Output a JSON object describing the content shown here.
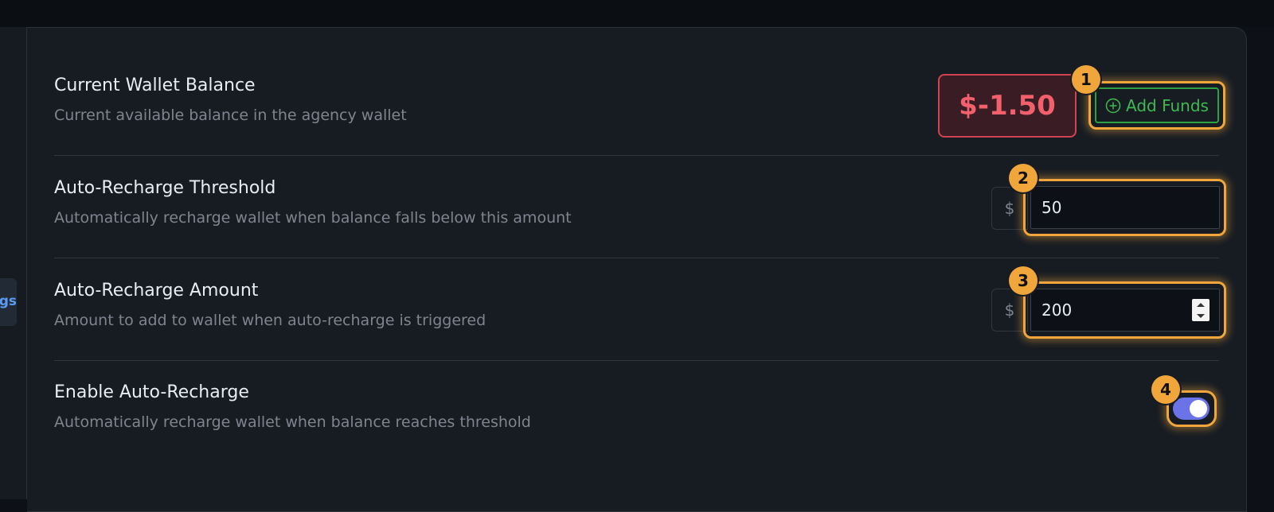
{
  "left_tab": {
    "label": "ngs"
  },
  "rows": [
    {
      "title": "Current Wallet Balance",
      "description": "Current available balance in the agency wallet"
    },
    {
      "title": "Auto-Recharge Threshold",
      "description": "Automatically recharge wallet when balance falls below this amount"
    },
    {
      "title": "Auto-Recharge Amount",
      "description": "Amount to add to wallet when auto-recharge is triggered"
    },
    {
      "title": "Enable Auto-Recharge",
      "description": "Automatically recharge wallet when balance reaches threshold"
    }
  ],
  "balance": {
    "value": "$-1.50",
    "color": "#f2606b"
  },
  "add_funds": {
    "label": "Add Funds",
    "icon": "plus-circle-icon",
    "color": "#3fb950"
  },
  "threshold": {
    "prefix": "$",
    "value": "50"
  },
  "amount": {
    "prefix": "$",
    "value": "200"
  },
  "auto_recharge": {
    "enabled": true,
    "color": "#6a73e8"
  },
  "markers": [
    "1",
    "2",
    "3",
    "4"
  ],
  "highlight_color": "#f0a63b"
}
